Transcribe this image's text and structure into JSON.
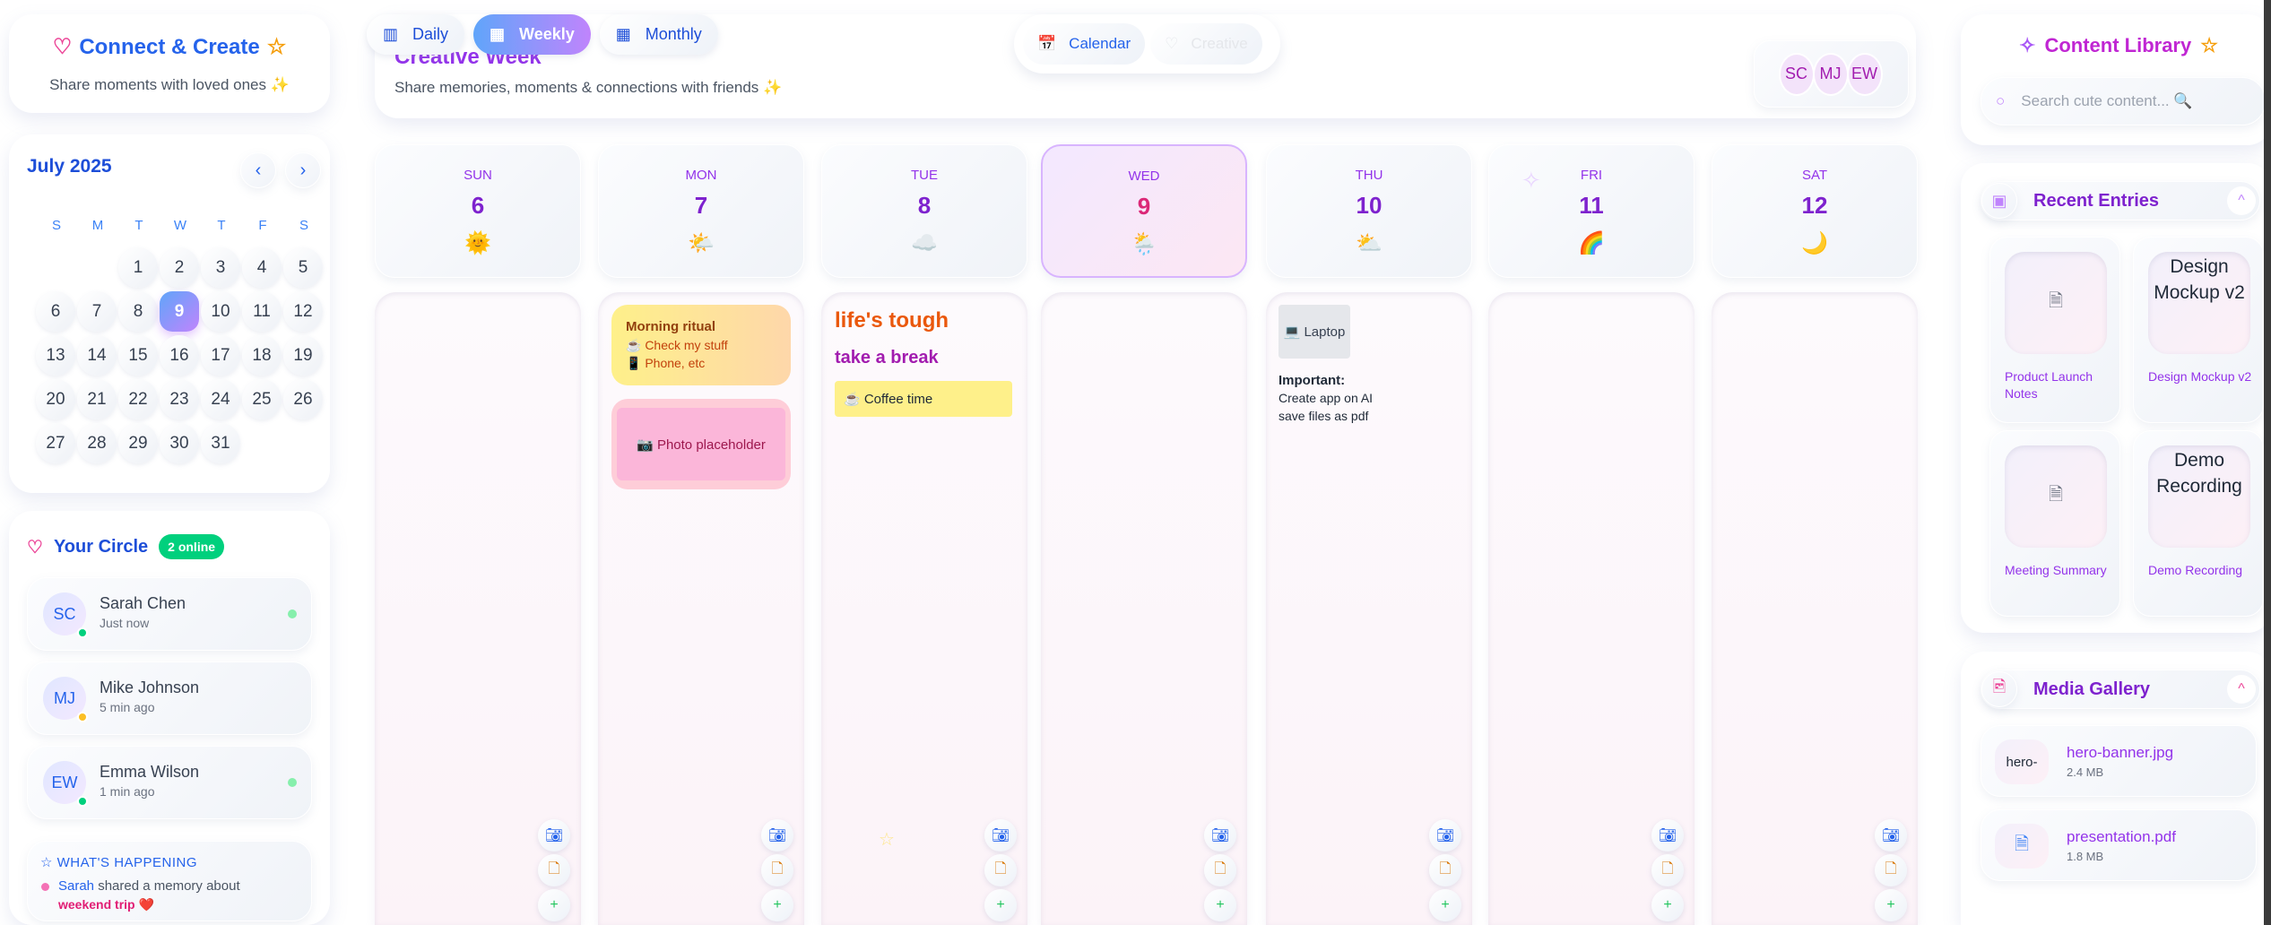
{
  "brand": {
    "title": "Connect & Create",
    "subtitle": "Share moments with loved ones ✨"
  },
  "mini_calendar": {
    "month": "July 2025",
    "prev": "‹",
    "next": "›",
    "weekdays": [
      "S",
      "M",
      "T",
      "W",
      "T",
      "F",
      "S"
    ],
    "leading_blanks": 2,
    "days": 31,
    "today": 9
  },
  "circle": {
    "title": "Your Circle",
    "badge": "2 online",
    "people": [
      {
        "initials": "SC",
        "name": "Sarah Chen",
        "time": "Just now",
        "status": "#00d07d",
        "online": true
      },
      {
        "initials": "MJ",
        "name": "Mike Johnson",
        "time": "5 min ago",
        "status": "#fbbf24",
        "online": false
      },
      {
        "initials": "EW",
        "name": "Emma Wilson",
        "time": "1 min ago",
        "status": "#00d07d",
        "online": true
      }
    ]
  },
  "happening": {
    "title": "WHAT'S HAPPENING",
    "user": "Sarah",
    "text": " shared a memory about",
    "highlight": "weekend trip ❤️"
  },
  "view_tabs": [
    {
      "label": "Daily",
      "icon": "▥"
    },
    {
      "label": "Weekly",
      "icon": "▦",
      "active": true
    },
    {
      "label": "Monthly",
      "icon": "▦"
    }
  ],
  "mode_toggle": [
    {
      "label": "Calendar",
      "icon": "📅"
    },
    {
      "label": "Creative",
      "icon": "♡"
    }
  ],
  "header": {
    "title": "Creative Week",
    "subtitle": "Share memories, moments & connections with friends ✨",
    "avatars": [
      "SC",
      "MJ",
      "EW"
    ]
  },
  "week": [
    {
      "name": "SUN",
      "date": "6",
      "weather": "🌞"
    },
    {
      "name": "MON",
      "date": "7",
      "weather": "🌤️"
    },
    {
      "name": "TUE",
      "date": "8",
      "weather": "☁️"
    },
    {
      "name": "WED",
      "date": "9",
      "weather": "🌦️",
      "today": true
    },
    {
      "name": "THU",
      "date": "10",
      "weather": "⛅"
    },
    {
      "name": "FRI",
      "date": "11",
      "weather": "🌈"
    },
    {
      "name": "SAT",
      "date": "12",
      "weather": "🌙"
    }
  ],
  "notes": {
    "morning": {
      "title": "Morning ritual",
      "line1": "☕ Check my stuff",
      "line2": "📱 Phone, etc"
    },
    "photo": "📷 Photo placeholder",
    "tough": "life's tough",
    "break": "take a break",
    "coffee": "☕ Coffee time",
    "laptop": "💻 Laptop",
    "important": "Important:",
    "imp1": "Create app on AI",
    "imp2": "save files as pdf"
  },
  "library": {
    "title": "Content Library",
    "search_placeholder": "Search cute content... 🔍"
  },
  "recent": {
    "title": "Recent Entries",
    "items": [
      {
        "label": "Product Launch Notes",
        "thumb": "🗎",
        "image": false
      },
      {
        "label": "Design Mockup v2",
        "thumb": "Design Mockup v2",
        "image": true
      },
      {
        "label": "Meeting Summary",
        "thumb": "🗎",
        "image": false
      },
      {
        "label": "Demo Recording",
        "thumb": "Demo Recording",
        "image": true
      }
    ]
  },
  "media": {
    "title": "Media Gallery",
    "items": [
      {
        "name": "hero-banner.jpg",
        "size": "2.4 MB",
        "thumb": "hero-"
      },
      {
        "name": "presentation.pdf",
        "size": "1.8 MB",
        "thumb": "🗎"
      }
    ]
  },
  "colors": {
    "accent_blue": "#2563eb",
    "accent_purple": "#9333ea",
    "pink": "#db2777",
    "online": "#00d07d"
  }
}
